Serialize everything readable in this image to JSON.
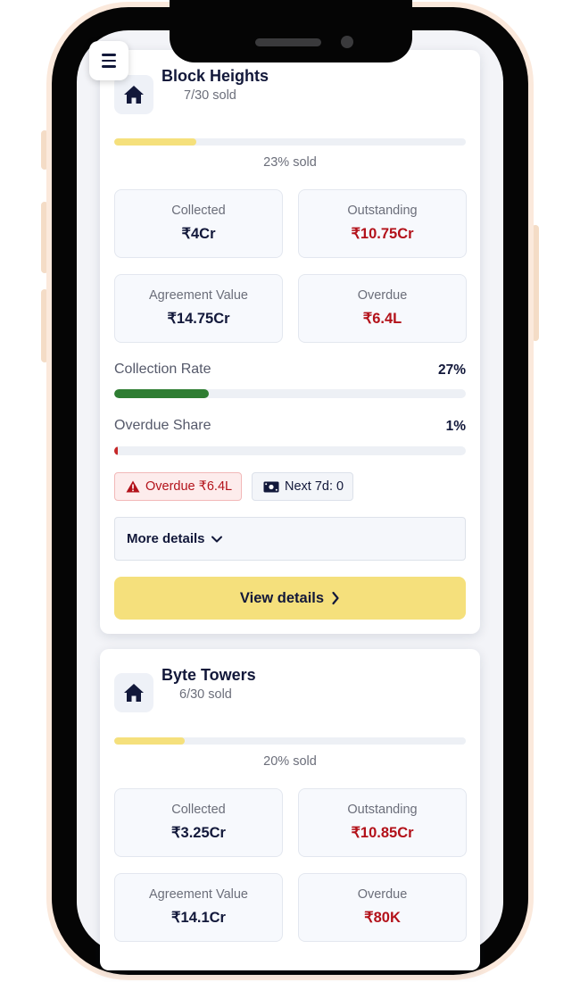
{
  "menu": {
    "icon": "hamburger-menu-icon"
  },
  "properties": [
    {
      "name": "Block Heights",
      "sold_text": "7/30 sold",
      "sold_fraction": 0.233,
      "sold_pct_text": "23% sold",
      "stats": {
        "collected_label": "Collected",
        "collected_value": "₹4Cr",
        "outstanding_label": "Outstanding",
        "outstanding_value": "₹10.75Cr",
        "agreement_label": "Agreement Value",
        "agreement_value": "₹14.75Cr",
        "overdue_label": "Overdue",
        "overdue_value": "₹6.4L"
      },
      "collection_rate": {
        "label": "Collection Rate",
        "value_text": "27%",
        "fraction": 0.27
      },
      "overdue_share": {
        "label": "Overdue Share",
        "value_text": "1%",
        "fraction": 0.01
      },
      "chips": {
        "overdue": "Overdue ₹6.4L",
        "next7d": "Next 7d: 0"
      },
      "more_details": "More details",
      "view_details": "View details"
    },
    {
      "name": "Byte Towers",
      "sold_text": "6/30 sold",
      "sold_fraction": 0.2,
      "sold_pct_text": "20% sold",
      "stats": {
        "collected_label": "Collected",
        "collected_value": "₹3.25Cr",
        "outstanding_label": "Outstanding",
        "outstanding_value": "₹10.85Cr",
        "agreement_label": "Agreement Value",
        "agreement_value": "₹14.1Cr",
        "overdue_label": "Overdue",
        "overdue_value": "₹80K"
      }
    }
  ],
  "colors": {
    "sold_bar": "#f5e07c",
    "collection_bar": "#2e7d32",
    "overdue_bar": "#c62828",
    "negative_text": "#b3121a",
    "navy": "#12183a"
  }
}
